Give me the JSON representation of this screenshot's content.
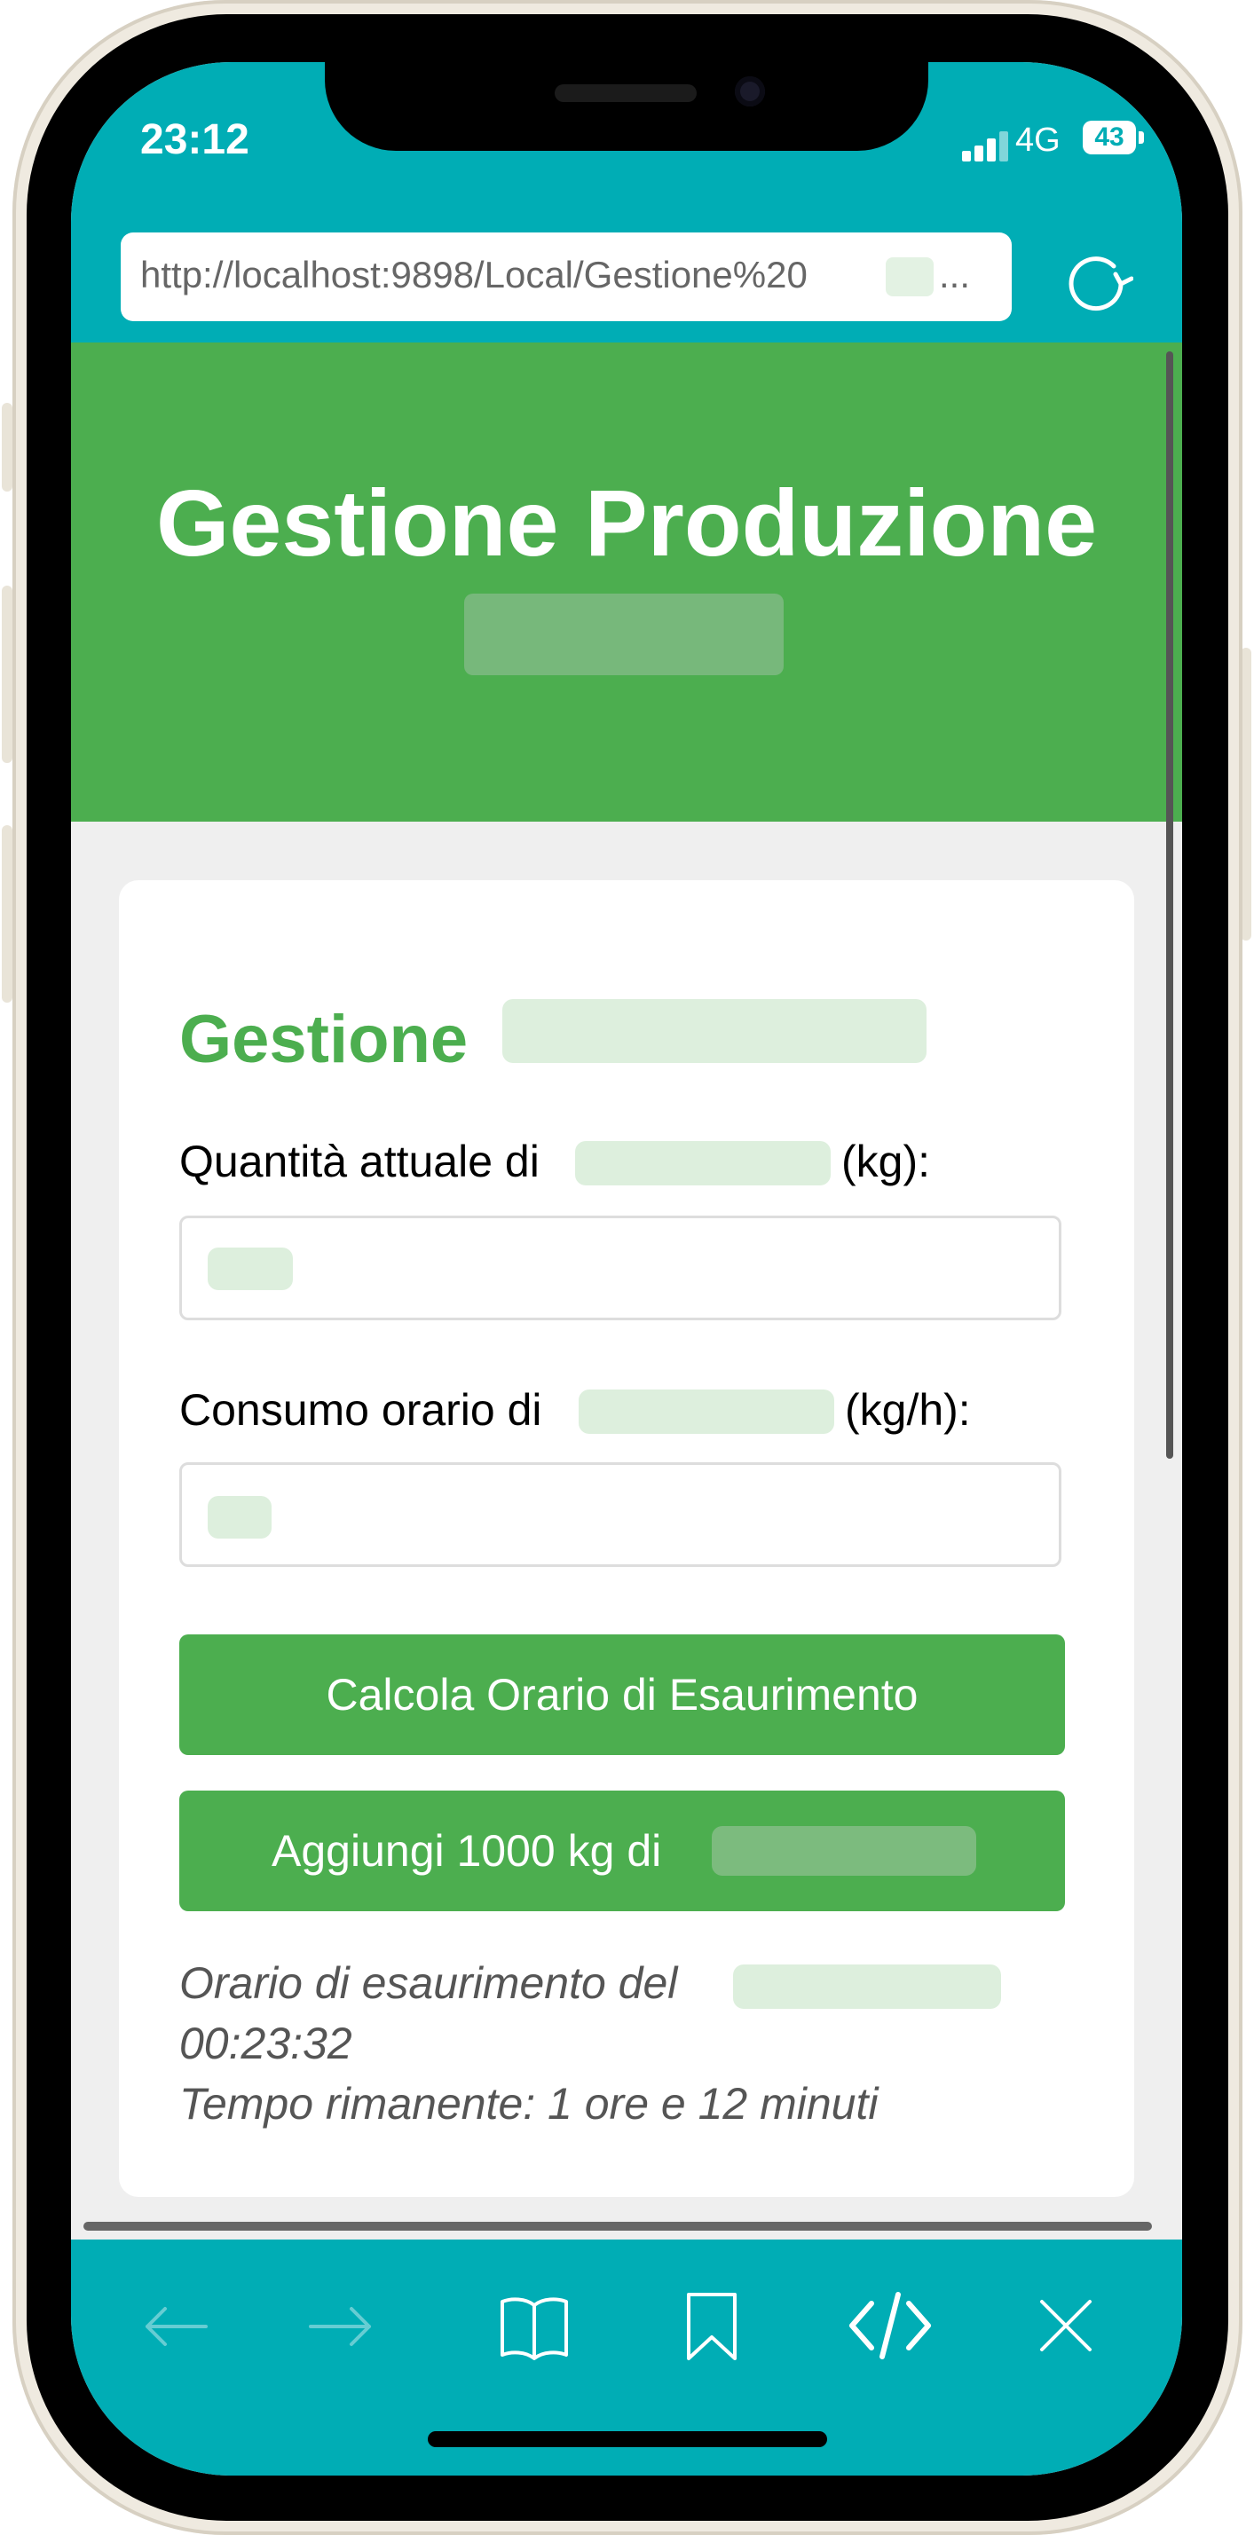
{
  "status": {
    "time": "23:12",
    "network": "4G",
    "battery": "43"
  },
  "browser": {
    "url": "http://localhost:9898/Local/Gestione%20",
    "url_ellipsis": "...",
    "reload_icon": "reload-icon"
  },
  "header": {
    "title": "Gestione Produzione"
  },
  "section": {
    "title": "Gestione",
    "quantity_label_prefix": "Quantità attuale di",
    "quantity_label_suffix": "(kg):",
    "consumption_label_prefix": "Consumo orario di",
    "consumption_label_suffix": "(kg/h):",
    "calc_button": "Calcola Orario di Esaurimento",
    "add_button_prefix": "Aggiungi 1000 kg di",
    "result_line1_prefix": "Orario di esaurimento del",
    "result_line2": "00:23:32",
    "result_line3": "Tempo rimanente: 1 ore e 12 minuti"
  },
  "toolbar": {
    "icons": [
      "back-arrow-icon",
      "forward-arrow-icon",
      "book-icon",
      "bookmark-icon",
      "code-icon",
      "close-icon"
    ]
  }
}
